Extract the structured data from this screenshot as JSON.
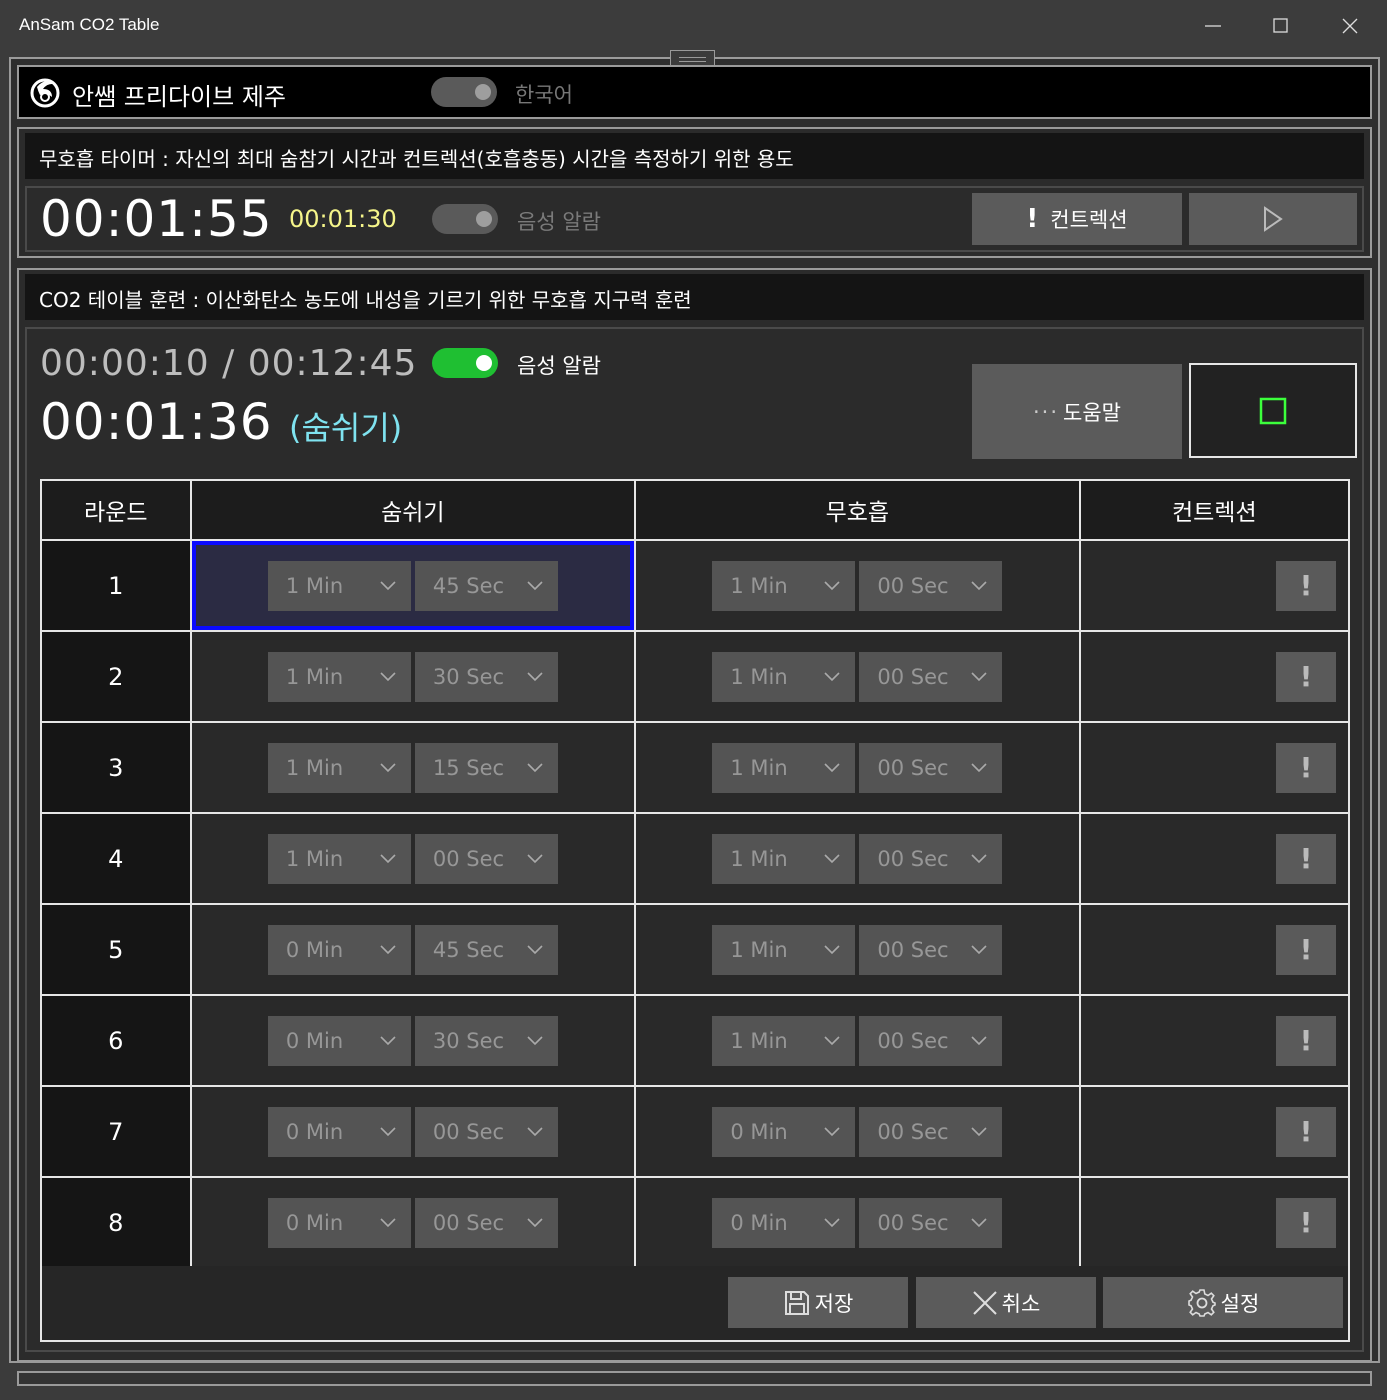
{
  "window": {
    "title": "AnSam CO2 Table",
    "minimize_icon": "minimize-icon",
    "maximize_icon": "maximize-icon",
    "close_icon": "close-icon"
  },
  "header": {
    "brand": "안쌤 프리다이브 제주",
    "language_label": "한국어",
    "language_toggle_on": false
  },
  "timer_panel": {
    "heading": "무호흡 타이머 : 자신의 최대 숨참기 시간과 컨트렉션(호흡충동) 시간을 측정하기 위한 용도",
    "main_time": "00:01:55",
    "contraction_time": "00:01:30",
    "voice_alarm_label": "음성 알람",
    "voice_alarm_on": false,
    "contraction_button": "컨트렉션",
    "contraction_icon": "exclamation-icon",
    "play_icon": "play-icon"
  },
  "co2_panel": {
    "heading": "CO2 테이블 훈련 : 이산화탄소 농도에 내성을 기르기 위한 무호흡 지구력 훈련",
    "elapsed": "00:00:10 / 00:12:45",
    "voice_alarm_label": "음성 알람",
    "voice_alarm_on": true,
    "current_time": "00:01:36",
    "phase": "(숨쉬기)",
    "help_button": "도움말",
    "help_icon": "ellipsis-icon",
    "stop_icon": "stop-icon",
    "colors": {
      "phase": "#7fe3f0",
      "toggle_on": "#1fbf32",
      "stop": "#3cff3c",
      "selection": "#0a0aff"
    }
  },
  "table": {
    "headers": [
      "라운드",
      "숨쉬기",
      "무호흡",
      "컨트렉션"
    ],
    "selected_round": 1,
    "rows": [
      {
        "round": "1",
        "breathe_min": "1 Min",
        "breathe_sec": "45 Sec",
        "hold_min": "1 Min",
        "hold_sec": "00 Sec"
      },
      {
        "round": "2",
        "breathe_min": "1 Min",
        "breathe_sec": "30 Sec",
        "hold_min": "1 Min",
        "hold_sec": "00 Sec"
      },
      {
        "round": "3",
        "breathe_min": "1 Min",
        "breathe_sec": "15 Sec",
        "hold_min": "1 Min",
        "hold_sec": "00 Sec"
      },
      {
        "round": "4",
        "breathe_min": "1 Min",
        "breathe_sec": "00 Sec",
        "hold_min": "1 Min",
        "hold_sec": "00 Sec"
      },
      {
        "round": "5",
        "breathe_min": "0 Min",
        "breathe_sec": "45 Sec",
        "hold_min": "1 Min",
        "hold_sec": "00 Sec"
      },
      {
        "round": "6",
        "breathe_min": "0 Min",
        "breathe_sec": "30 Sec",
        "hold_min": "1 Min",
        "hold_sec": "00 Sec"
      },
      {
        "round": "7",
        "breathe_min": "0 Min",
        "breathe_sec": "00 Sec",
        "hold_min": "0 Min",
        "hold_sec": "00 Sec"
      },
      {
        "round": "8",
        "breathe_min": "0 Min",
        "breathe_sec": "00 Sec",
        "hold_min": "0 Min",
        "hold_sec": "00 Sec"
      }
    ]
  },
  "footer": {
    "save": "저장",
    "cancel": "취소",
    "settings": "설정",
    "save_icon": "floppy-disk-icon",
    "cancel_icon": "x-icon",
    "settings_icon": "gear-icon"
  }
}
